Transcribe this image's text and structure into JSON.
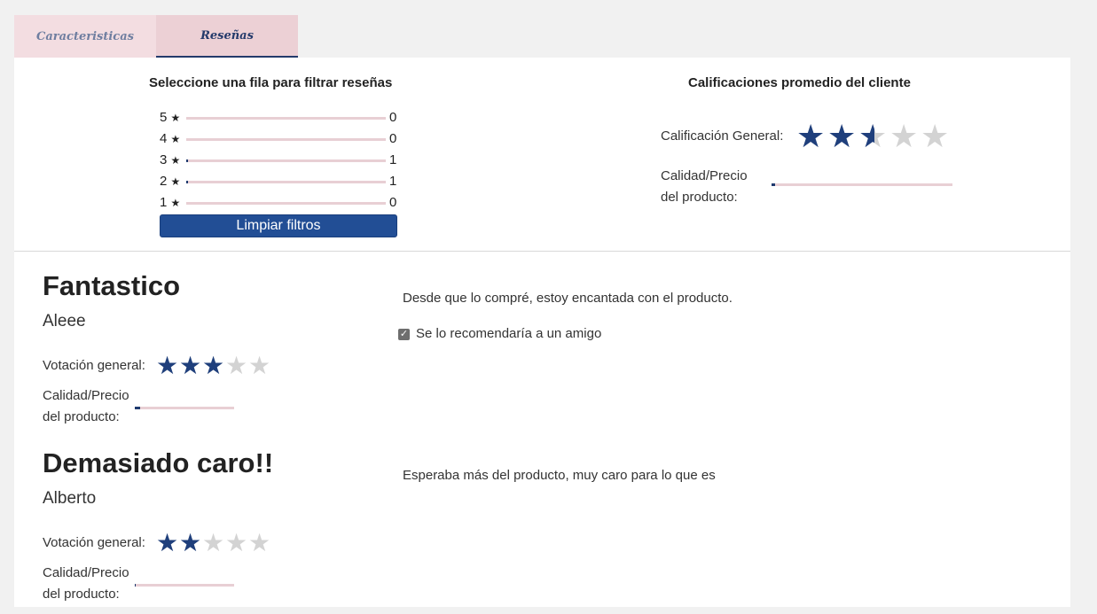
{
  "tabs": [
    {
      "label": "Caracteristicas"
    },
    {
      "label": "Reseñas"
    }
  ],
  "filter": {
    "title": "Seleccione una fila para filtrar reseñas",
    "star_glyph": "★",
    "rows": [
      {
        "label": "5",
        "count": "0",
        "fraction": 0
      },
      {
        "label": "4",
        "count": "0",
        "fraction": 0
      },
      {
        "label": "3",
        "count": "1",
        "fraction": 0.01
      },
      {
        "label": "2",
        "count": "1",
        "fraction": 0.01
      },
      {
        "label": "1",
        "count": "0",
        "fraction": 0
      }
    ],
    "clear_button": "Limpiar filtros"
  },
  "averages": {
    "title": "Calificaciones promedio del cliente",
    "overall_label": "Calificación General:",
    "overall_rating": 2.5,
    "value_label_line1": "Calidad/Precio",
    "value_label_line2": "del producto:",
    "value_fraction": 0.02
  },
  "reviews": [
    {
      "title": "Fantastico",
      "author": "Aleee",
      "rating_label": "Votación general:",
      "rating": 3,
      "value_label_line1": "Calidad/Precio",
      "value_label_line2": "del producto:",
      "value_fraction": 0.05,
      "body": "Desde que lo compré, estoy encantada con el producto.",
      "recommend": "Se lo recomendaría a un amigo"
    },
    {
      "title": "Demasiado caro!!",
      "author": "Alberto",
      "rating_label": "Votación general:",
      "rating": 2,
      "value_label_line1": "Calidad/Precio",
      "value_label_line2": "del producto:",
      "value_fraction": 0.01,
      "body": "Esperaba más del producto, muy caro para lo que es"
    }
  ],
  "colors": {
    "accent": "#224e95",
    "star_filled": "#1f3f7c",
    "star_empty": "#d3d3d3",
    "bar_track": "#e8cfd4",
    "tab_active_bg": "#ecd0d5",
    "tab_inactive_bg": "#f3dde1"
  }
}
